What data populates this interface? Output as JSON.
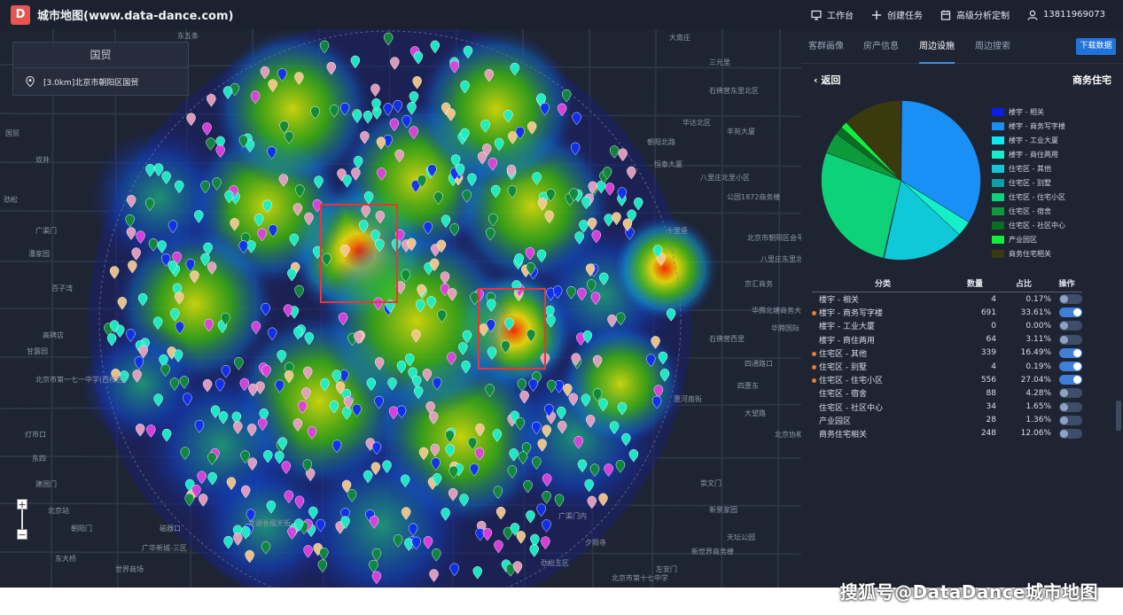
{
  "app": {
    "logo_text": "D",
    "title": "城市地图(www.data-dance.com)"
  },
  "top_actions": [
    {
      "icon": "monitor-icon",
      "label": "工作台"
    },
    {
      "icon": "plus-icon",
      "label": "创建任务"
    },
    {
      "icon": "calendar-icon",
      "label": "高级分析定制"
    },
    {
      "icon": "user-icon",
      "label": "13811969073"
    }
  ],
  "search_panel": {
    "title": "国贸",
    "location": "[3.0km]北京市朝阳区国贸"
  },
  "map_labels": [
    "东五条",
    "大南庄",
    "三元里",
    "石佛营东里北区",
    "丰苑大厦",
    "华达北区",
    "朝阳北路",
    "恒泰大厦",
    "八里庄北里小区",
    "公园1872商务楼",
    "北京市朝阳区会平安",
    "十里堡",
    "八里庄东里北区",
    "京汇商务",
    "华腾北塘商务大厦",
    "华腾国际",
    "石佛营西里",
    "四通路口",
    "四惠东",
    "惠河南街",
    "大望路",
    "国贸",
    "双井",
    "劲松",
    "广渠门",
    "潘家园",
    "百子湾",
    "高碑店",
    "甘露园",
    "北京市第一七一中学(西校区)",
    "灯市口",
    "东四",
    "建国门",
    "北京站",
    "朝阳门",
    "东大桥",
    "新世界商务楼",
    "新景家园",
    "北京协和医院",
    "崇文门",
    "磁器口",
    "天坛公园",
    "广渠门内",
    "夕照寺",
    "左安门",
    "劲松五区",
    "北京市第十七中学",
    "广华新城-三区",
    "龙湖长楹天街",
    "世界商场"
  ],
  "tabs": [
    "客群画像",
    "房产信息",
    "周边设施",
    "周边搜索"
  ],
  "active_tab": "周边设施",
  "download_label": "下载数据",
  "back_label": "返回",
  "subtitle": "商务住宅",
  "colors": {
    "accent": "#2173d9",
    "dot": "#e87d2b",
    "topbar": "#1c2130",
    "panel": "#1f2433"
  },
  "chart_data": {
    "type": "pie",
    "title": "商务住宅",
    "categories": [
      "楼宇 - 相关",
      "楼宇 - 商务写字楼",
      "楼宇 - 工业大厦",
      "楼宇 - 商住两用",
      "住宅区 - 其他",
      "住宅区 - 别墅",
      "住宅区 - 住宅小区",
      "住宅区 - 宿舍",
      "住宅区 - 社区中心",
      "产业园区",
      "商务住宅相关"
    ],
    "values": [
      4,
      691,
      0,
      64,
      339,
      4,
      556,
      88,
      34,
      28,
      248
    ],
    "colors": [
      "#0a1ee6",
      "#1890f5",
      "#13e6f0",
      "#14f0c8",
      "#0fc8d8",
      "#0aa0a8",
      "#0ed278",
      "#0d9a3a",
      "#0a6e22",
      "#12ee3c",
      "#3a3a0e"
    ],
    "legend_position": "right"
  },
  "table": {
    "headers": [
      "分类",
      "数量",
      "占比",
      "操作"
    ],
    "rows": [
      {
        "name": "楼宇 - 相关",
        "count": "4",
        "pct": "0.17%",
        "on": false,
        "dot": false
      },
      {
        "name": "楼宇 - 商务写字楼",
        "count": "691",
        "pct": "33.61%",
        "on": true,
        "dot": true
      },
      {
        "name": "楼宇 - 工业大厦",
        "count": "0",
        "pct": "0.00%",
        "on": false,
        "dot": false
      },
      {
        "name": "楼宇 - 商住两用",
        "count": "64",
        "pct": "3.11%",
        "on": false,
        "dot": false
      },
      {
        "name": "住宅区 - 其他",
        "count": "339",
        "pct": "16.49%",
        "on": true,
        "dot": true
      },
      {
        "name": "住宅区 - 别墅",
        "count": "4",
        "pct": "0.19%",
        "on": true,
        "dot": true
      },
      {
        "name": "住宅区 - 住宅小区",
        "count": "556",
        "pct": "27.04%",
        "on": true,
        "dot": true
      },
      {
        "name": "住宅区 - 宿舍",
        "count": "88",
        "pct": "4.28%",
        "on": false,
        "dot": false
      },
      {
        "name": "住宅区 - 社区中心",
        "count": "34",
        "pct": "1.65%",
        "on": false,
        "dot": false
      },
      {
        "name": "产业园区",
        "count": "28",
        "pct": "1.36%",
        "on": false,
        "dot": false
      },
      {
        "name": "商务住宅相关",
        "count": "248",
        "pct": "12.06%",
        "on": false,
        "dot": false
      }
    ]
  },
  "watermark": "搜狐号@DataDance城市地图"
}
